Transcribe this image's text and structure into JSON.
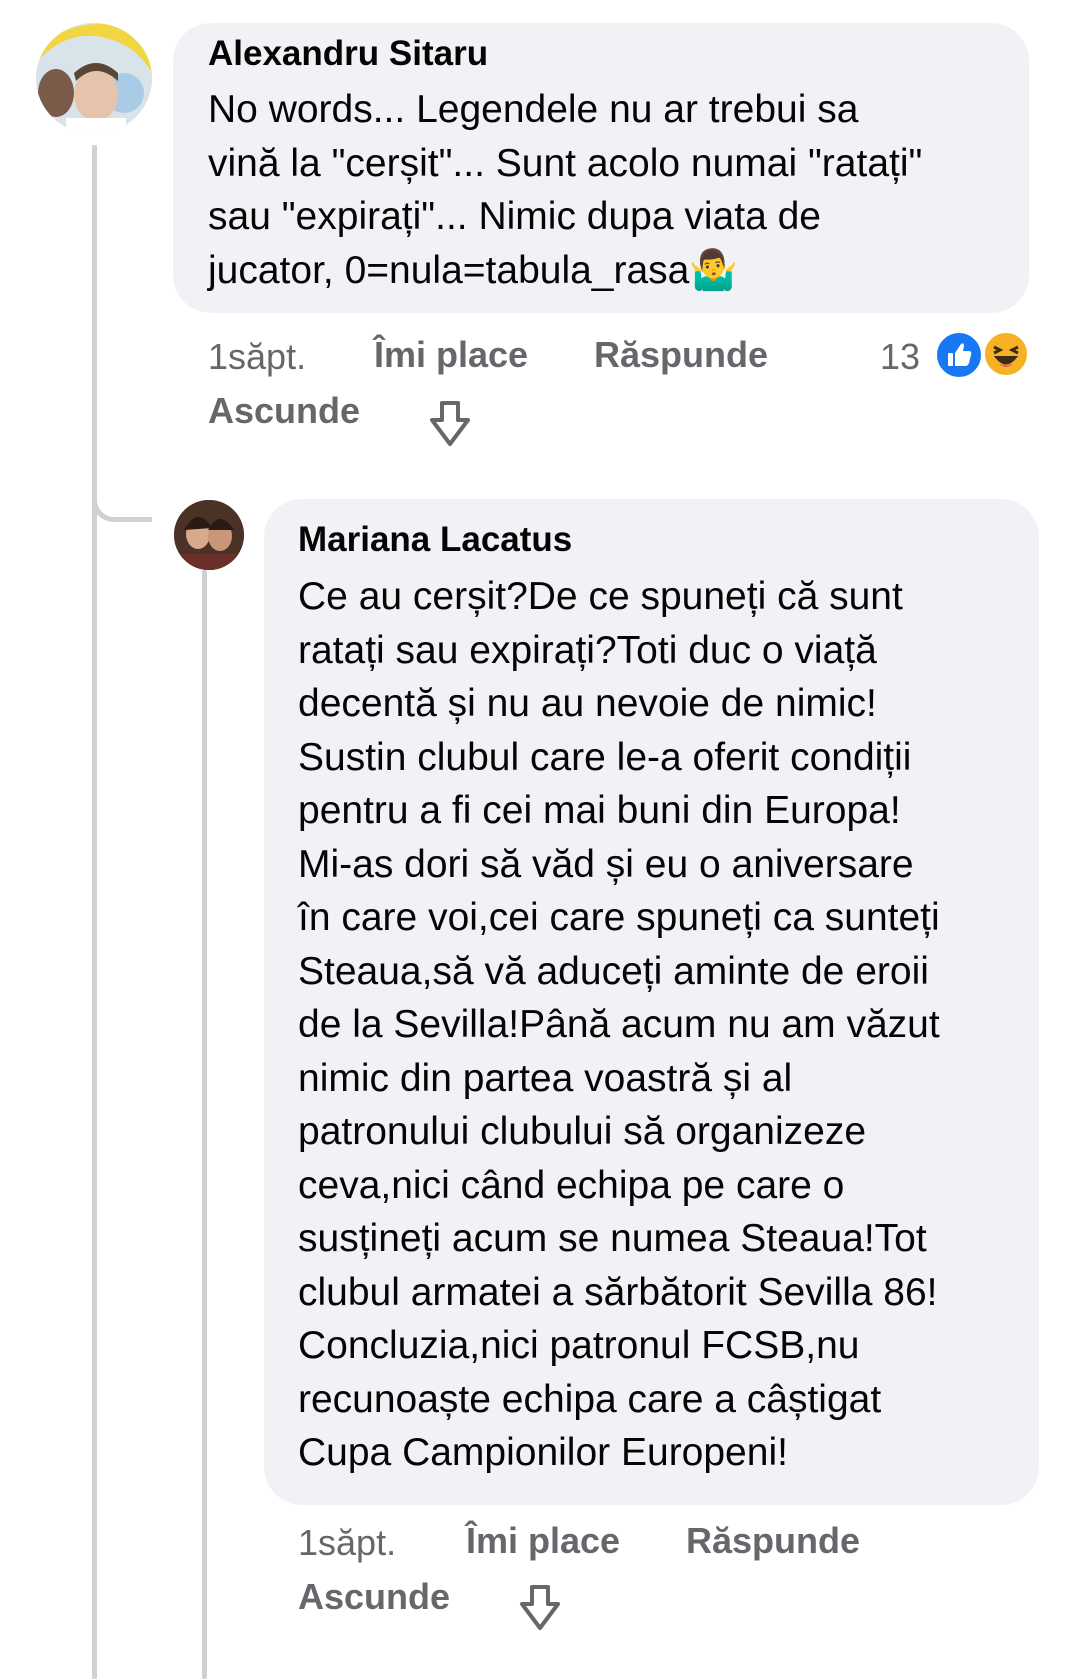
{
  "comment": {
    "author": "Alexandru Sitaru",
    "text": "No words... Legendele nu ar trebui sa\nvină la \"cerșit\"... Sunt acolo numai \"ratați\"\nsau \"expirați\"... Nimic dupa viata de\njucator, 0=nula=tabula_rasa🤷‍♂️",
    "time": "1săpt.",
    "like_label": "Îmi place",
    "reply_label": "Răspunde",
    "hide_label": "Ascunde",
    "reaction_count": "13",
    "reactions": [
      "like-icon",
      "haha-icon"
    ]
  },
  "reply": {
    "author": "Mariana Lacatus",
    "text": "Ce au cerșit?De ce spuneți că sunt\nratați sau expirați?Toti duc o viață\ndecentă și nu au nevoie de nimic!\nSustin clubul care le-a oferit condiții\npentru a fi cei mai buni din Europa!\nMi-as dori să văd și eu o aniversare\nîn care voi,cei care spuneți ca sunteți\nSteaua,să vă aduceți aminte de eroii\nde la Sevilla!Până acum nu am văzut\nnimic din partea voastră și al\npatronului clubului să organizeze\nceva,nici când echipa pe care o\nsusțineți acum se numea Steaua!Tot\nclubul armatei a sărbătorit Sevilla 86!\nConcluzia,nici patronul FCSB,nu\nrecunoaște echipa care a câștigat\nCupa Campionilor Europeni!",
    "time": "1săpt.",
    "like_label": "Îmi place",
    "reply_label": "Răspunde",
    "hide_label": "Ascunde"
  },
  "colors": {
    "bubble": "#f0f2f5",
    "meta_text": "#65676b",
    "thread_line": "#ced0d4",
    "like_blue": "#1877f2",
    "haha_yellow": "#f7b125"
  }
}
